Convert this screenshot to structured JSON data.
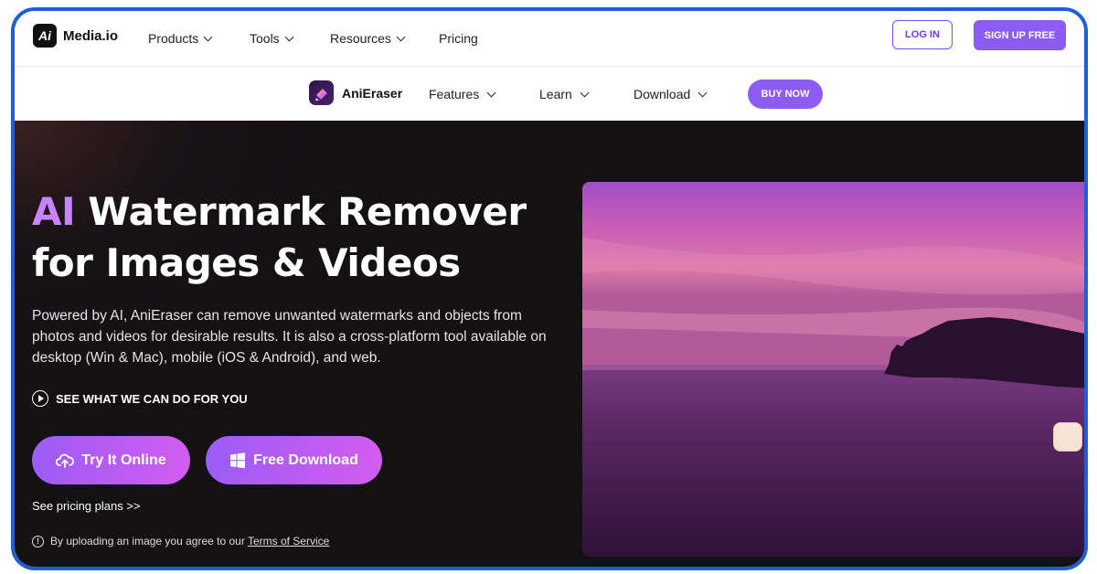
{
  "topnav": {
    "logo_mark": "Ai",
    "brand": "Media.io",
    "items": [
      {
        "label": "Products",
        "has_dropdown": true
      },
      {
        "label": "Tools",
        "has_dropdown": true
      },
      {
        "label": "Resources",
        "has_dropdown": true
      },
      {
        "label": "Pricing",
        "has_dropdown": false
      }
    ],
    "login": "LOG IN",
    "signup": "SIGN UP FREE"
  },
  "subnav": {
    "app_name": "AniEraser",
    "items": [
      {
        "label": "Features"
      },
      {
        "label": "Learn"
      },
      {
        "label": "Download"
      }
    ],
    "buy": "BUY NOW"
  },
  "hero": {
    "headline_accent": "AI",
    "headline_line1_rest": " Watermark Remover",
    "headline_line2": "for Images & Videos",
    "description": "Powered by AI, AniEraser can remove unwanted watermarks and objects from photos and videos for desirable results. It is also a cross-platform tool available on desktop (Win & Mac), mobile (iOS & Android), and web.",
    "see_what": "SEE WHAT WE CAN DO FOR YOU",
    "try_button": "Try It Online",
    "download_button": "Free Download",
    "pricing_link": "See pricing plans >>",
    "terms_prefix": "By uploading an image you agree to our ",
    "terms_link": "Terms of Service"
  },
  "colors": {
    "accent": "#8b5cf6",
    "frame_border": "#1f5fd6",
    "hero_bg": "#141113"
  },
  "icons": [
    "logo-mark-icon",
    "chevron-down-icon",
    "aniearser-app-icon",
    "play-circle-icon",
    "cloud-upload-icon",
    "windows-icon",
    "info-icon",
    "chat-icon"
  ]
}
